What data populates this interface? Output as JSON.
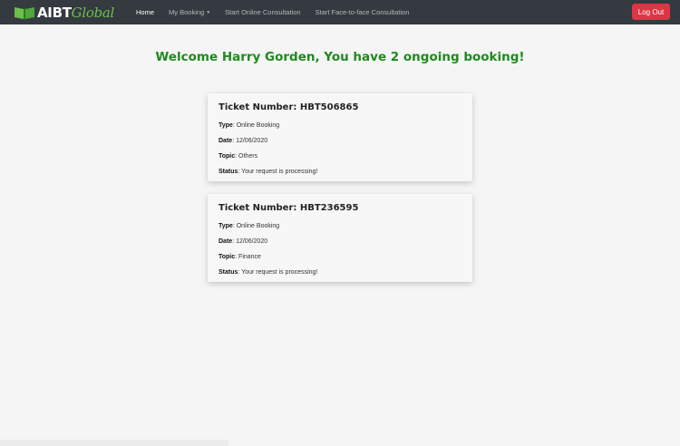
{
  "navbar": {
    "brand_main": "AIBT",
    "brand_accent": "Global",
    "links": [
      {
        "label": "Home"
      },
      {
        "label": "My Booking"
      },
      {
        "label": "Start Online Consultation"
      },
      {
        "label": "Start Face-to-face Consultation"
      }
    ],
    "logout_label": "Log Out"
  },
  "welcome": "Welcome Harry Gorden, You have 2 ongoing booking!",
  "labels": {
    "type": "Type",
    "date": "Date",
    "topic": "Topic",
    "status": "Status"
  },
  "bookings": [
    {
      "ticket": "Ticket Number: HBT506865",
      "type": "Online Booking",
      "date": "12/06/2020",
      "topic": "Others",
      "status": "Your request is processing!"
    },
    {
      "ticket": "Ticket Number: HBT236595",
      "type": "Online Booking",
      "date": "12/06/2020",
      "topic": "Finance",
      "status": "Your request is processing!"
    }
  ],
  "colors": {
    "navbar": "#343a40",
    "logout": "#dc3545",
    "welcome": "#1e8a1e",
    "brand_accent": "#6cc04a"
  }
}
